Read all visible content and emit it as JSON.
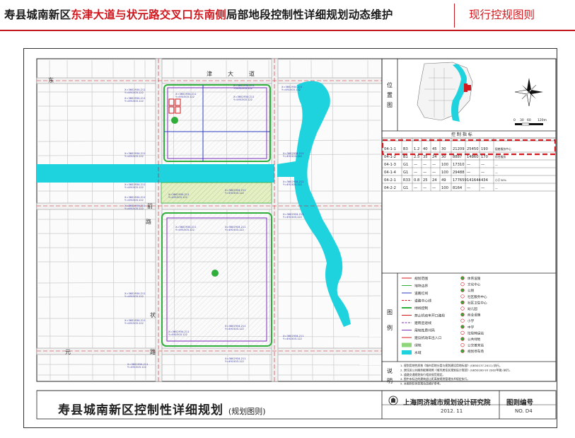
{
  "header": {
    "title_pre": "寿县城南新区",
    "title_red": "东津大道与状元路交叉口东南侧",
    "title_post": "局部地段控制性详细规划动态维护",
    "right_label": "现行控规图则"
  },
  "map": {
    "road_labels": [
      "东",
      "津",
      "大",
      "道",
      "前",
      "路",
      "状",
      "元",
      "路"
    ],
    "location_label": [
      "位",
      "置",
      "图"
    ],
    "legend_label": [
      "图",
      "例"
    ],
    "notes_label": [
      "说",
      "明"
    ],
    "scale_ticks": [
      "0",
      "30",
      "60",
      "120m"
    ],
    "coord_label": "X=3602934.211 / Y=491503.122"
  },
  "control_table": {
    "title": "控 制 指 标",
    "rows": [
      [
        "04-1-1",
        "B3",
        "1.2",
        "40",
        "45",
        "30",
        "21209",
        "25450",
        "190",
        "配套服务中心"
      ],
      [
        "04-1-2",
        "B1",
        "2.5",
        "35",
        "24",
        "30",
        "8887",
        "14860",
        "170",
        "综合服务"
      ],
      [
        "04-1-3",
        "G1",
        "—",
        "—",
        "—",
        "100",
        "17310",
        "—",
        "—",
        "—"
      ],
      [
        "04-1-4",
        "G1",
        "—",
        "—",
        "—",
        "100",
        "29488",
        "—",
        "—",
        "—"
      ],
      [
        "04-2-1",
        "R33",
        "0.8",
        "25",
        "24",
        "49",
        "177659",
        "141644",
        "434",
        "小于30%"
      ],
      [
        "04-2-2",
        "G1",
        "—",
        "—",
        "—",
        "100",
        "8164",
        "—",
        "—",
        "—"
      ]
    ]
  },
  "legend": {
    "left": [
      "规划范围",
      "地块边界",
      "道路红线",
      "道路中心线",
      "绿线控制",
      "禁止机动车开口路段",
      "建筑后退线",
      "用地性质代码",
      "建议机动车出入口",
      "绿地",
      "水域"
    ],
    "right": [
      "体育设施",
      "文化中心",
      "公厕",
      "社区服务中心",
      "社区卫生中心",
      "幼儿园",
      "商业设施",
      "小学",
      "中学",
      "垃圾转运站",
      "公共绿地",
      "公交首末站",
      "规划停车场"
    ]
  },
  "notes": [
    "1. 规划用地性质按《城市用地分类与规划建设用地标准》(GB50137-2011) 执行。",
    "2. 居住区公共服务配套按照《城市居住区规划设计规范》(GB50180-93 2002年版) 执行。",
    "3. 道路交通规划执行相关规范规定。",
    "4. 图中未标注的建筑退让距离按规划管理技术规定执行。",
    "5. 本图则仅供控规动态维护参考。"
  ],
  "footer": {
    "title_main": "寿县城南新区控制性详细规划",
    "title_sub": "(规划图则)",
    "institute": "上海同济城市规划设计研究院",
    "date": "2012. 11",
    "drawing_no_label": "图则编号",
    "drawing_no": "NO. D4"
  },
  "colors": {
    "accent_red": "#d0181e",
    "water": "#1fd3de",
    "green_line": "#2fae3c",
    "boundary_purple": "#7b2fbe",
    "road_blue": "#2b3fbf"
  }
}
